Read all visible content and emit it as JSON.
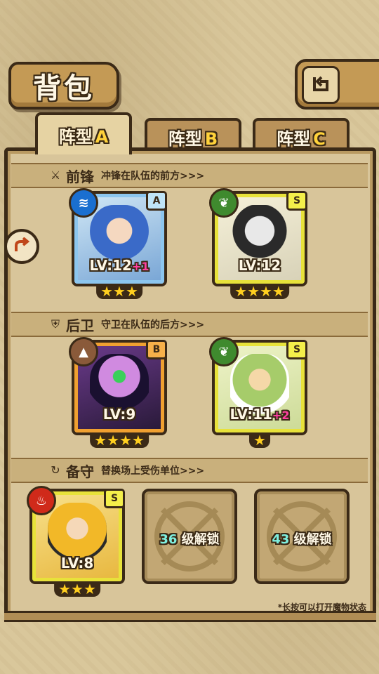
{
  "title": "背包",
  "tabs": [
    {
      "label": "阵型",
      "letter": "A",
      "active": true
    },
    {
      "label": "阵型",
      "letter": "B",
      "active": false
    },
    {
      "label": "阵型",
      "letter": "C",
      "active": false
    }
  ],
  "sections": {
    "front": {
      "name": "前锋",
      "desc": "冲锋在队伍的前方>>>"
    },
    "back": {
      "name": "后卫",
      "desc": "守卫在队伍的后方>>>"
    },
    "reserve": {
      "name": "备守",
      "desc": "替换场上受伤单位>>>"
    }
  },
  "cards": {
    "front1": {
      "rank": "A",
      "element": "water",
      "level": "LV:12",
      "bonus": "+1",
      "stars": "★★★"
    },
    "front2": {
      "rank": "S",
      "element": "grass",
      "level": "LV:12",
      "bonus": "",
      "stars": "★★★★"
    },
    "back1": {
      "rank": "B",
      "element": "earth",
      "level": "LV:9",
      "bonus": "",
      "stars": "★★★★"
    },
    "back2": {
      "rank": "S",
      "element": "grass",
      "level": "LV:11",
      "bonus": "+2",
      "stars": "★"
    },
    "reserve1": {
      "rank": "S",
      "element": "fire",
      "level": "LV:8",
      "bonus": "",
      "stars": "★★★"
    }
  },
  "locked_slots": [
    {
      "level": "36",
      "text": "级解锁"
    },
    {
      "level": "43",
      "text": "级解锁"
    }
  ],
  "hint": "*长按可以打开魔物状态",
  "icons": {
    "back": "return-arrow-icon",
    "side": "turn-arrow-icon",
    "water": "water-wave-icon",
    "grass": "leaf-icon",
    "earth": "mountain-icon",
    "fire": "flame-icon"
  }
}
